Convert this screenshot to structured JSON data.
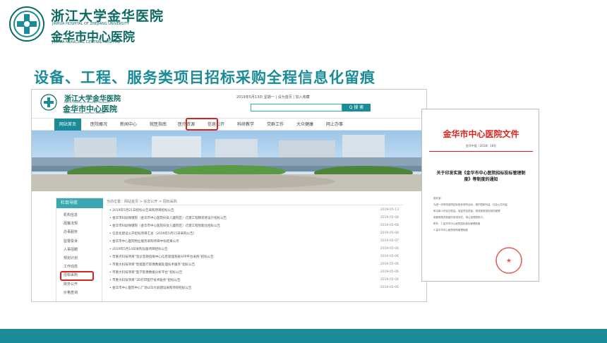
{
  "slide": {
    "logo_cn": "浙江大学金华医院",
    "logo_en1": "JINHUA HOSPITAL OF ZHEJIANG UNIVERSITY",
    "logo_cn2": "金华市中心医院",
    "logo_en2": "JINHUA MUNICIPAL CENTRAL HOSPITAL",
    "heading": "设备、工程、服务类项目招标采购全程信息化留痕",
    "colors": {
      "teal": "#1a8c97",
      "dark_green": "#0b6b63",
      "red": "#d9231d"
    }
  },
  "site": {
    "name1": "浙江大学金华医院",
    "name1_en": "JINHUA HOSPITAL OF ZHEJIANG UNIVERSITY",
    "name2": "金华市中心医院",
    "name2_en": "JINHUA MUNICIPAL CENTRAL HOSPITAL",
    "topline": "2019年5月13日 星期一 | 设为首页 | 加入收藏",
    "search_button": "Q 搜 索",
    "nav": [
      "网站首页",
      "医院概况",
      "新闻中心",
      "就医指南",
      "医疗资源",
      "信息公开",
      "科研教学",
      "党群工作",
      "大众健康",
      "网上办事"
    ],
    "nav_active": "网站首页",
    "side_title": "栏目导航",
    "side_items": [
      "机构信息",
      "政策法规",
      "办事服务",
      "监督投诉",
      "人事招聘",
      "规划计划",
      "工作动态",
      "招标采购",
      "院务公开",
      "价格查询"
    ],
    "breadcrumb": "当前位置：网站首页 > 信息公开 > 招标采购",
    "list": [
      {
        "title": "2019年5月21日招标公告采购项目招标公告",
        "date": "2019-05-13"
      },
      {
        "title": "金华市妇幼保健院（金华市中心医院妇女儿童院区）迁建工程精装修设计招标公告",
        "date": "2019-05-08"
      },
      {
        "title": "金华市妇幼保健院（金华市中心医院妇女儿童院区）迁建工程智能化招标公告",
        "date": "2019-05-08"
      },
      {
        "title": "信息化建设公开招标项目汇总（2019年5月15日采购公告）",
        "date": "2019-05-08"
      },
      {
        "title": "金华市中心医院物业服务采购项目中标结果公示",
        "date": "2019-05-07"
      },
      {
        "title": "2019年5月14日采购设备项目招标公告",
        "date": "2019-05-06"
      },
      {
        "title": "市重点科技项目“急诊急救指挥中心信息管理系统APP平台采购”招标公告",
        "date": "2019-05-06"
      },
      {
        "title": "市重大科技项目“智能医疗影像数据处理技术服务”招标公告",
        "date": "2019-05-06"
      },
      {
        "title": "市重大科技项目“医学影像数据分析平台”招标公告",
        "date": "2019-05-06"
      },
      {
        "title": "市重大科技项目“3D打印医疗技术服务”招标公告",
        "date": "2019-05-06"
      },
      {
        "title": "金华市中心医院中心广场LED大屏建设采购项目招标公告",
        "date": "2019-05-06"
      }
    ]
  },
  "doc": {
    "title": "金华市中心医院文件",
    "number": "金华中医〔2018〕18号",
    "subject": "关于印发实施《金华市中心医院招标投标管理制度》等制度的通知",
    "body": [
      "各科室：",
      "为进一步规范医院招标投标采购活动，维护国家利益、社会公共利益",
      "和当事人的合法权益，保证项目质量，现将医院招标投标管理",
      "制度等相关制度印发给你们，请认真遵照执行。",
      "附件：1.金华市中心医院招标投标管理制度",
      "2.金华市中心医院采购管理制度"
    ],
    "seal_text": "金华市中心医院"
  }
}
